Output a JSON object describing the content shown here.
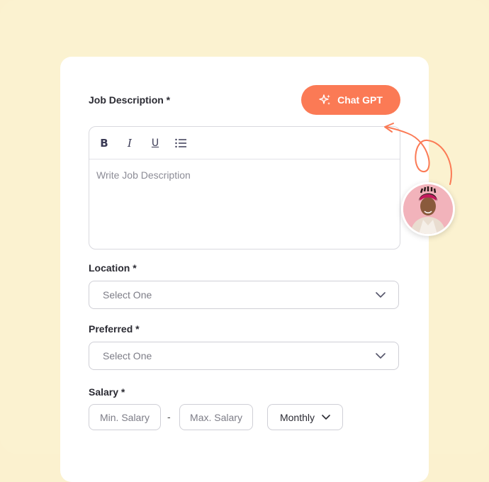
{
  "form": {
    "job_description_label": "Job Description *",
    "chat_button_label": "Chat GPT",
    "editor_placeholder": "Write Job Description",
    "toolbar": {
      "bold": "B",
      "italic": "I",
      "underline": "U"
    },
    "location_label": "Location *",
    "location_value": "Select One",
    "preferred_label": "Preferred *",
    "preferred_value": "Select One",
    "salary_label": "Salary *",
    "min_salary_placeholder": "Min. Salary",
    "separator": "-",
    "max_salary_placeholder": "Max. Salary",
    "period_value": "Monthly"
  },
  "colors": {
    "accent": "#fb7a55",
    "background": "#fbf2d0"
  },
  "icons": {
    "chat_button": "sparkle-icon",
    "select": "chevron-down-icon",
    "list": "list-icon"
  }
}
